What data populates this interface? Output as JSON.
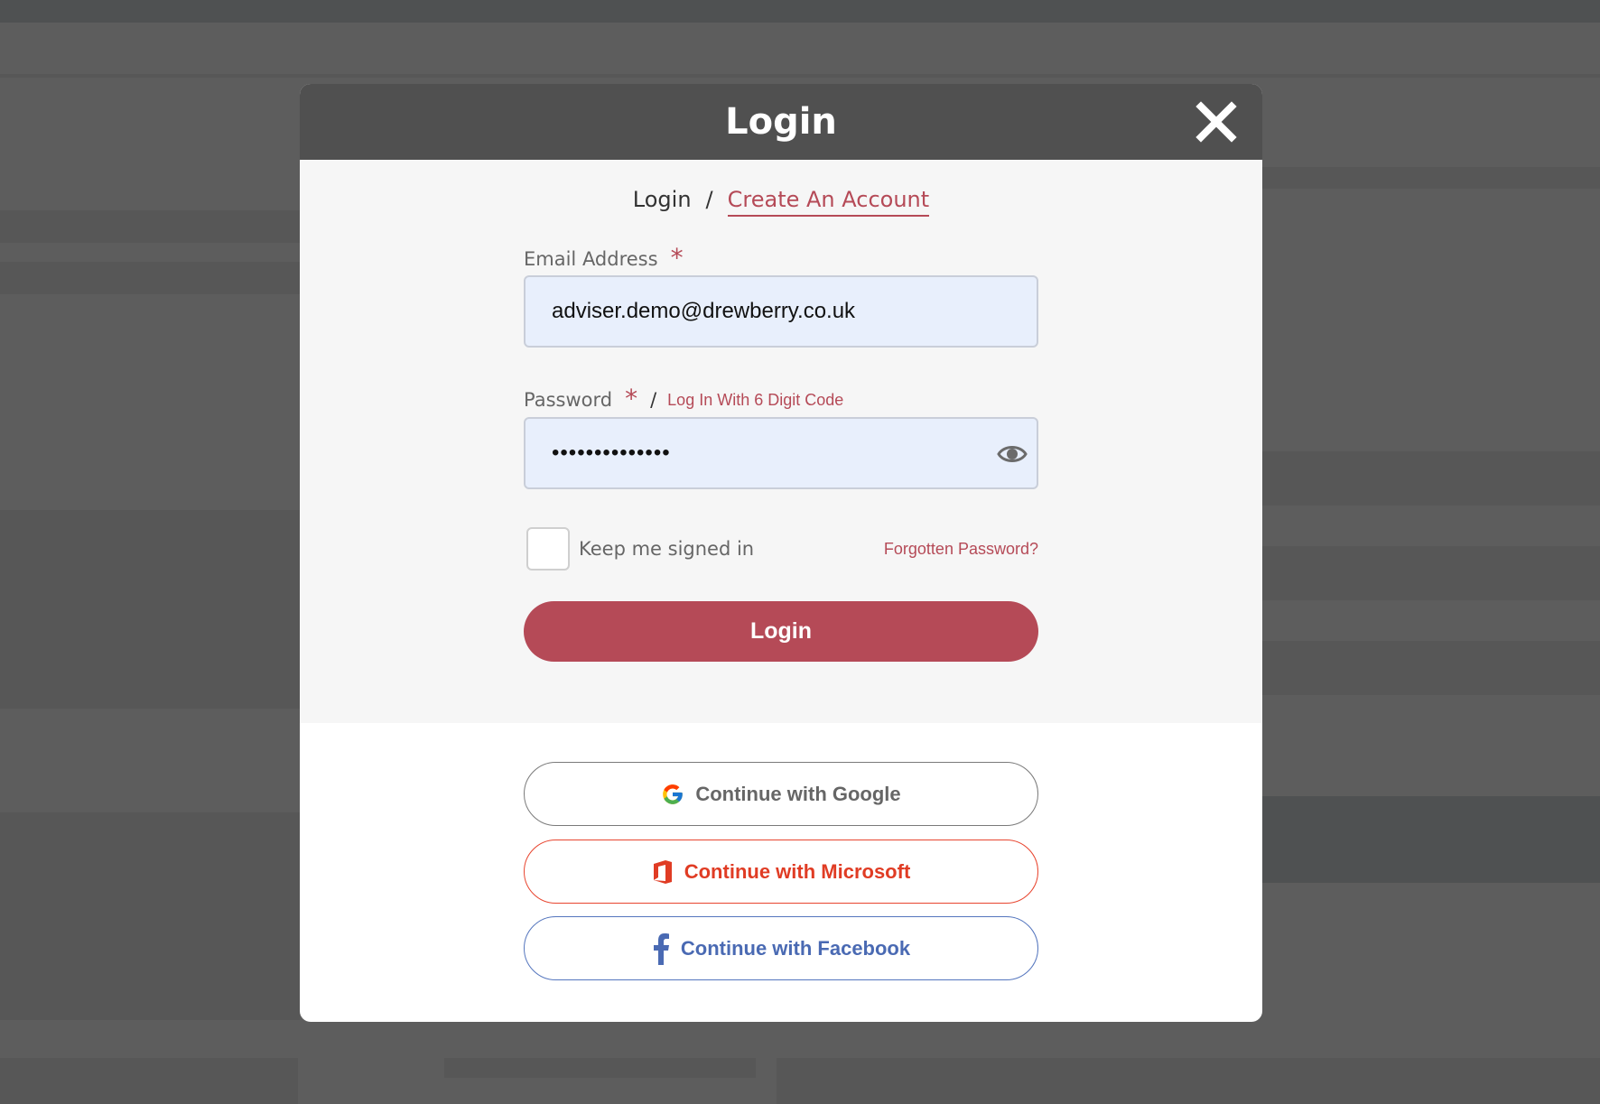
{
  "modal": {
    "title": "Login",
    "close_icon": "close-icon"
  },
  "tabs": {
    "login": "Login",
    "separator": "/",
    "create_account": "Create An Account"
  },
  "email": {
    "label": "Email Address",
    "required_mark": "*",
    "value": "adviser.demo@drewberry.co.uk"
  },
  "password": {
    "label": "Password",
    "required_mark": "*",
    "separator": "/",
    "code_link": "Log In With 6 Digit Code",
    "masked_value": "••••••••••••••",
    "toggle_icon": "eye-icon"
  },
  "options": {
    "keep_signed_in": "Keep me signed in",
    "keep_signed_in_checked": false,
    "forgot_password": "Forgotten Password?"
  },
  "login_button": "Login",
  "social": {
    "google": "Continue with Google",
    "microsoft": "Continue with Microsoft",
    "facebook": "Continue with Facebook"
  },
  "colors": {
    "accent": "#b54a57",
    "header_bg": "#505050",
    "input_bg": "#e8effc",
    "microsoft": "#e03c24",
    "facebook": "#4a6ab3"
  }
}
